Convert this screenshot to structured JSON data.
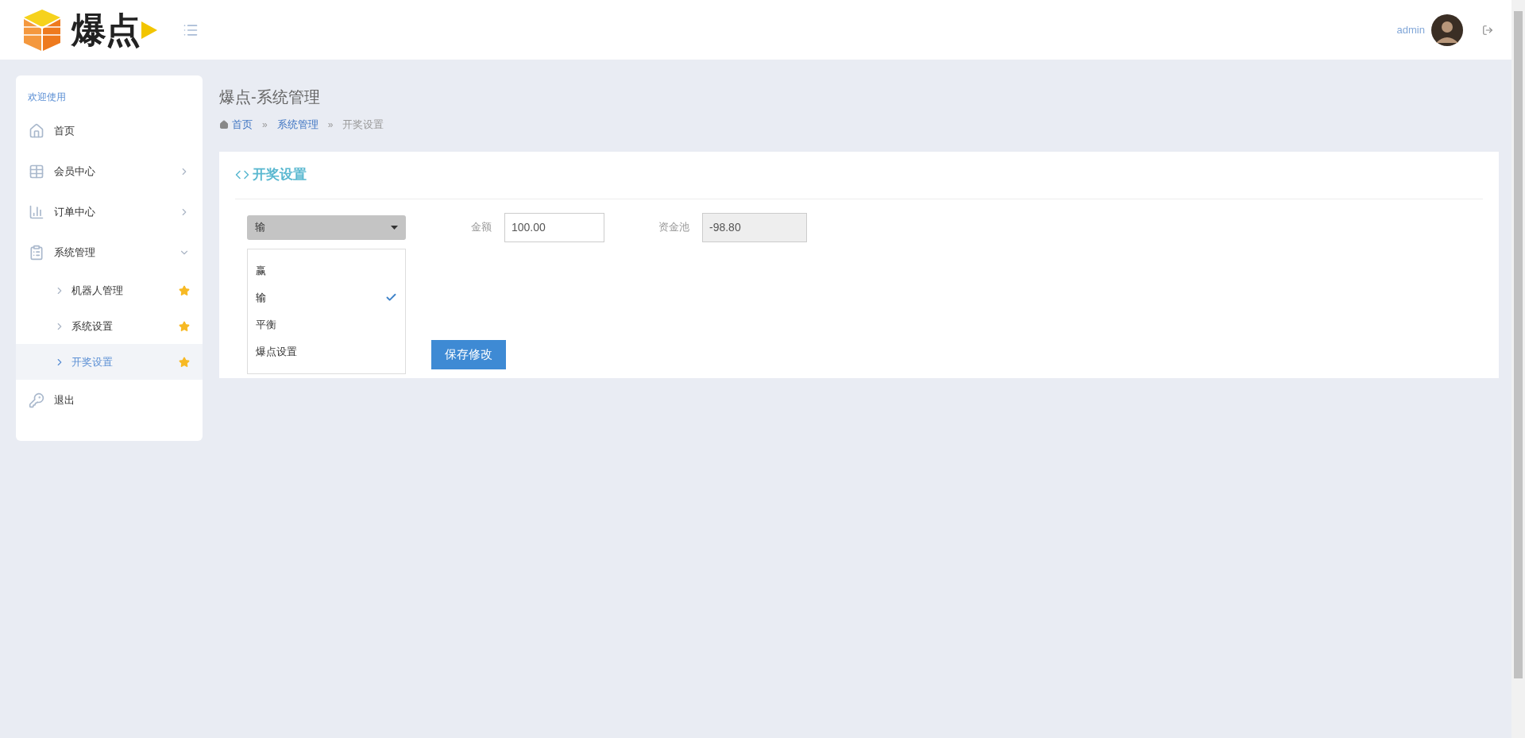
{
  "header": {
    "logo_text": "爆点",
    "user": "admin"
  },
  "sidebar": {
    "heading": "欢迎使用",
    "items": [
      {
        "label": "首页",
        "kind": "home"
      },
      {
        "label": "会员中心",
        "kind": "table",
        "expanded": false
      },
      {
        "label": "订单中心",
        "kind": "chart",
        "expanded": false
      },
      {
        "label": "系统管理",
        "kind": "list",
        "expanded": true,
        "children": [
          {
            "label": "机器人管理",
            "selected": false
          },
          {
            "label": "系统设置",
            "selected": false
          },
          {
            "label": "开奖设置",
            "selected": true
          }
        ]
      },
      {
        "label": "退出",
        "kind": "key"
      }
    ]
  },
  "page": {
    "title": "爆点-系统管理",
    "breadcrumb": [
      {
        "label": "首页",
        "kind": "home"
      },
      {
        "separator": "»",
        "label": "系统管理",
        "kind": "link"
      },
      {
        "separator": "»",
        "label": "开奖设置",
        "kind": "current"
      }
    ]
  },
  "card": {
    "title": "开奖设置",
    "select": {
      "value": "输",
      "expanded": true,
      "options": [
        {
          "label": "赢",
          "selected": false
        },
        {
          "label": "输",
          "selected": true
        },
        {
          "label": "平衡",
          "selected": false
        },
        {
          "label": "爆点设置",
          "selected": false
        }
      ]
    },
    "amount": {
      "label": "金额",
      "value": "100.00"
    },
    "pool": {
      "label": "资金池",
      "value": "-98.80",
      "disabled": true
    },
    "save_button": "保存修改"
  }
}
